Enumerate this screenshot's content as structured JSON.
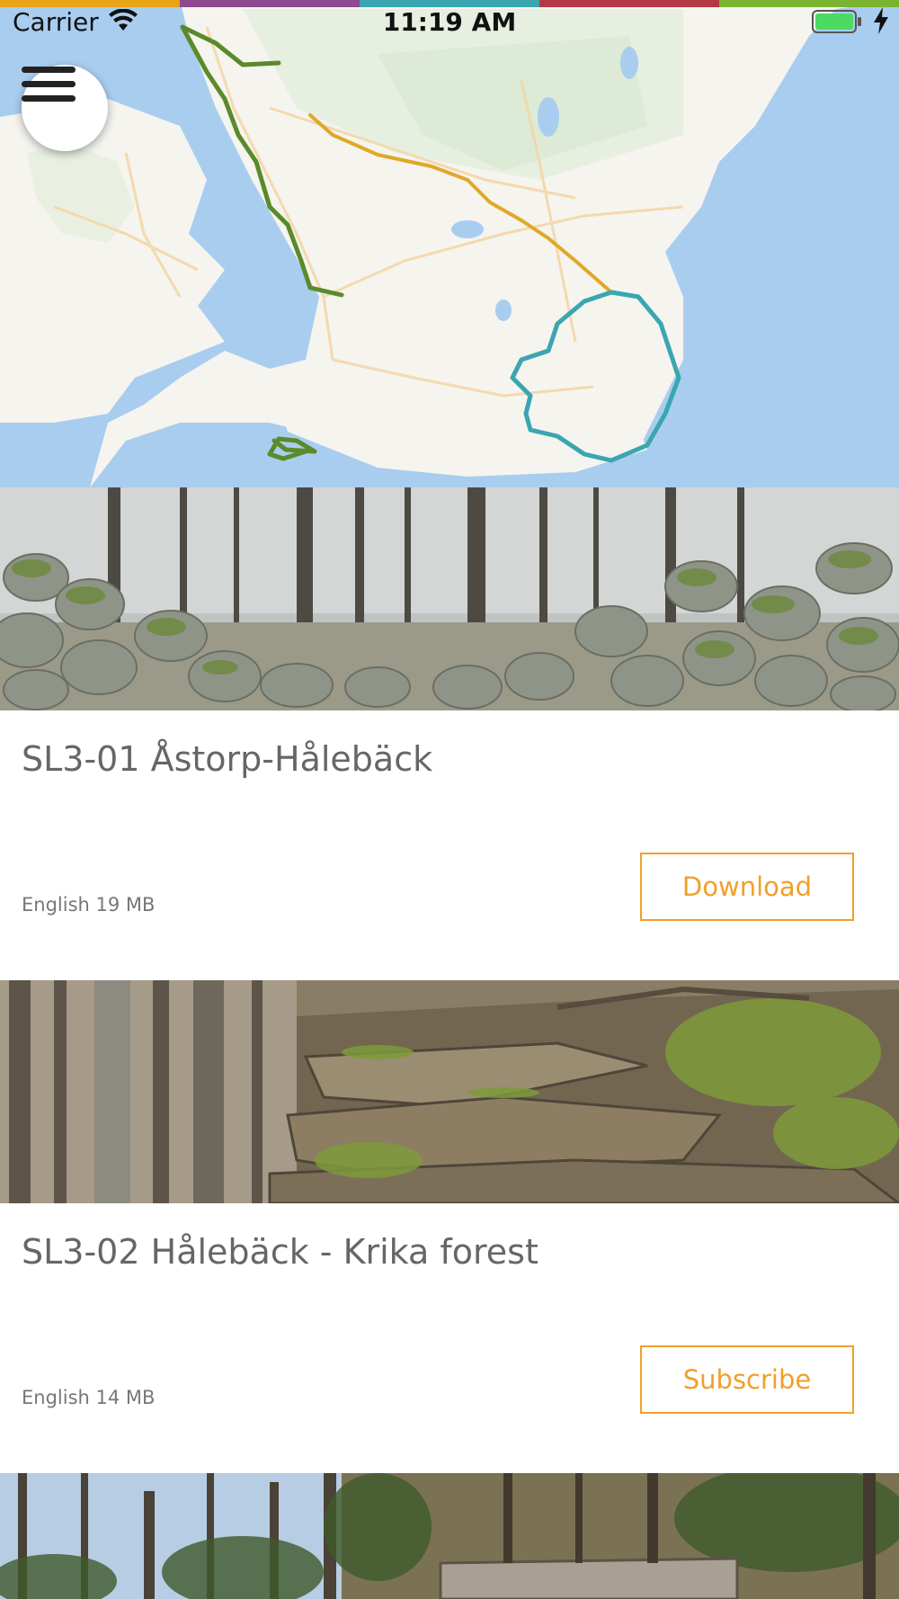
{
  "status_bar": {
    "carrier": "Carrier",
    "time": "11:19 AM",
    "icons": [
      "wifi-icon",
      "battery-icon",
      "charging-bolt-icon"
    ]
  },
  "top_stripe_colors": [
    "#e8a317",
    "#8e4a8e",
    "#3aa6b0",
    "#b33a45",
    "#7bb431"
  ],
  "map": {
    "menu_icon": "hamburger-menu-icon",
    "route_colors": [
      "#5a8a2a",
      "#e0a826",
      "#3aa6b0"
    ]
  },
  "trails": [
    {
      "title": "SL3-01 Åstorp-Hålebäck",
      "meta": "English 19 MB",
      "action": "Download"
    },
    {
      "title": "SL3-02 Hålebäck - Krika forest",
      "meta": "English 14 MB",
      "action": "Subscribe"
    }
  ]
}
